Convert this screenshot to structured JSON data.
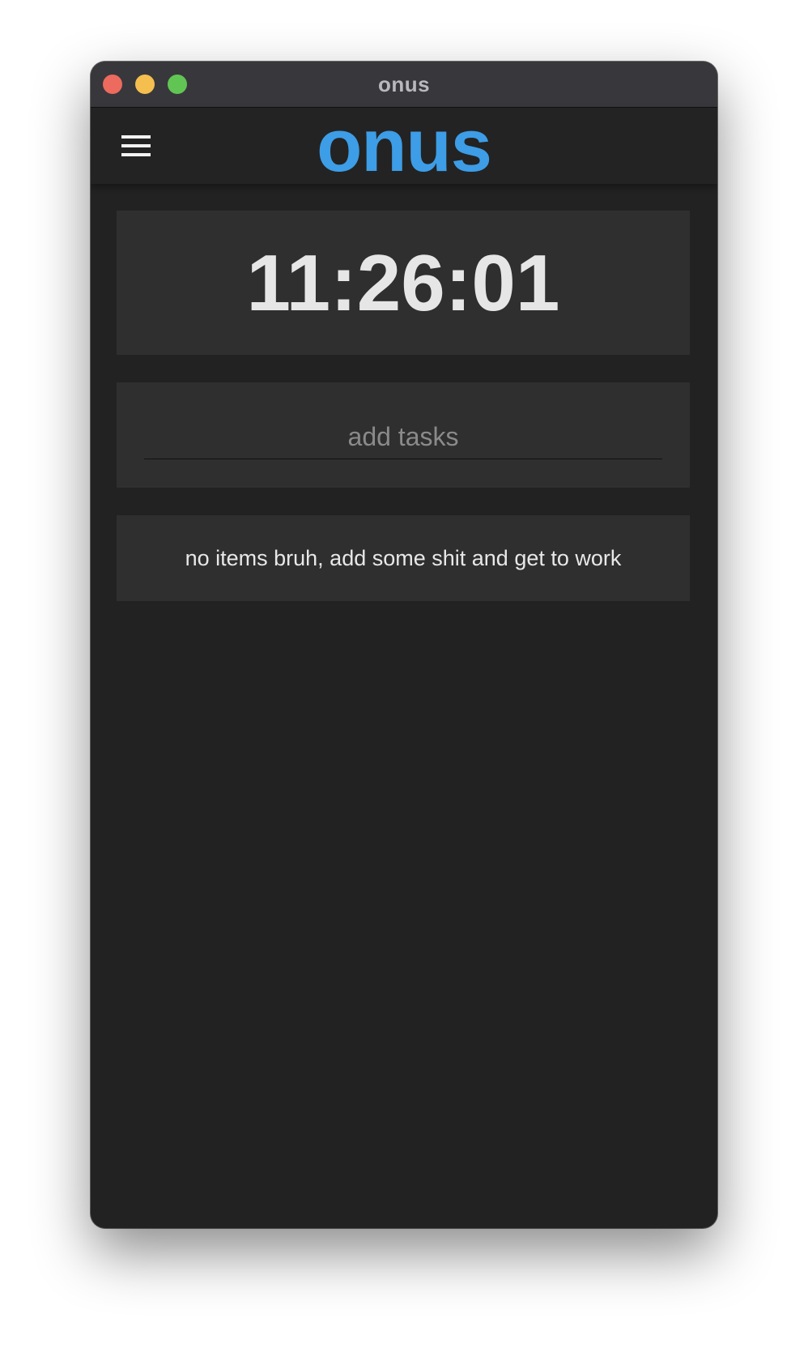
{
  "window": {
    "title": "onus"
  },
  "app": {
    "brand": "onus",
    "brand_color": "#3d9de6",
    "menu_icon": "hamburger-menu-icon"
  },
  "clock": {
    "time": "11:26:01"
  },
  "task_input": {
    "value": "",
    "placeholder": "add tasks"
  },
  "task_list": {
    "items": [],
    "empty_message": "no items bruh, add some shit and get to work"
  },
  "colors": {
    "background": "#222222",
    "card": "#2f2f2f",
    "titlebar": "#38373c"
  }
}
